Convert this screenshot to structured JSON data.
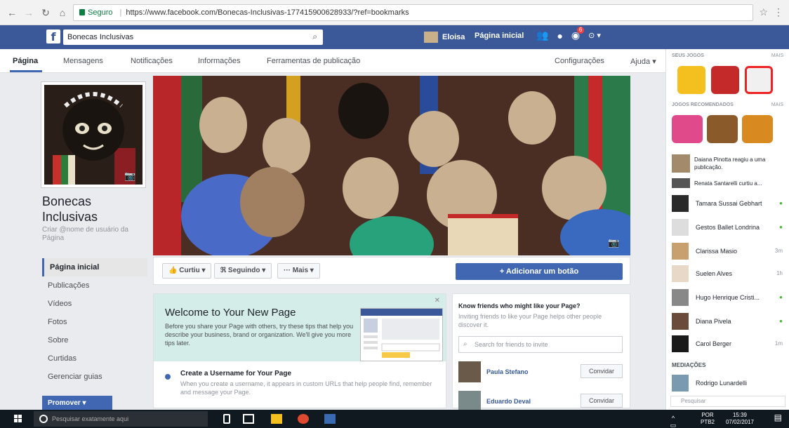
{
  "browser": {
    "secure_label": "Seguro",
    "url": "https://www.facebook.com/Bonecas-Inclusivas-177415900628933/?ref=bookmarks"
  },
  "fb_header": {
    "search_value": "Bonecas Inclusivas",
    "user_name": "Eloisa",
    "home_label": "Página inicial",
    "friend_badge": "",
    "notif_badge": "6"
  },
  "page_nav": {
    "tabs": [
      "Página",
      "Mensagens",
      "Notificações",
      "Informações",
      "Ferramentas de publicação"
    ],
    "settings": "Configurações",
    "help": "Ajuda ▾"
  },
  "left": {
    "page_name_line1": "Bonecas",
    "page_name_line2": "Inclusivas",
    "username_hint": "Criar @nome de usuário da Página",
    "menu": [
      "Página inicial",
      "Publicações",
      "Vídeos",
      "Fotos",
      "Sobre",
      "Curtidas",
      "Gerenciar guias"
    ],
    "promote": "Promover"
  },
  "actions": {
    "like": "Curtiu ▾",
    "following": "Seguindo ▾",
    "more": "··· Mais ▾",
    "add_button": "+ Adicionar um botão"
  },
  "welcome": {
    "title": "Welcome to Your New Page",
    "text": "Before you share your Page with others, try these tips that help you describe your business, brand or organization. We'll give you more tips later.",
    "step_title": "Create a Username for Your Page",
    "step_text": "When you create a username, it appears in custom URLs that help people find, remember and message your Page."
  },
  "invite": {
    "title": "Know friends who might like your Page?",
    "text": "Inviting friends to like your Page helps other people discover it.",
    "search_placeholder": "Search for friends to invite",
    "friends": [
      {
        "name": "Paula Stefano",
        "button": "Convidar"
      },
      {
        "name": "Eduardo Deval",
        "button": "Convidar"
      }
    ]
  },
  "right": {
    "games_head": "SEUS JOGOS",
    "games_more": "MAIS",
    "reco_head": "JOGOS RECOMENDADOS",
    "reco_more": "MAIS",
    "activity": "Daiana Pinotta reagiu a uma publicação.",
    "activity2": "Renata Santarelli curtiu a...",
    "contacts": [
      {
        "name": "Tamara Sussai Gebhart",
        "status": "●"
      },
      {
        "name": "Gestos Ballet Londrina",
        "status": "●"
      },
      {
        "name": "Clarissa Masio",
        "status": "3m"
      },
      {
        "name": "Suelen Alves",
        "status": "1h"
      },
      {
        "name": "Hugo Henrique Cristi...",
        "status": "●"
      },
      {
        "name": "Diana Pivela",
        "status": "●"
      },
      {
        "name": "Carol Berger",
        "status": "1m"
      }
    ],
    "section": "MEDIAÇÕES",
    "section_contact": "Rodrigo Lunardelli",
    "search_placeholder": "Pesquisar"
  },
  "taskbar": {
    "search_placeholder": "Pesquisar exatamente aqui",
    "lang": "POR",
    "lang2": "PTB2",
    "time": "15:39",
    "date": "07/02/2017"
  }
}
